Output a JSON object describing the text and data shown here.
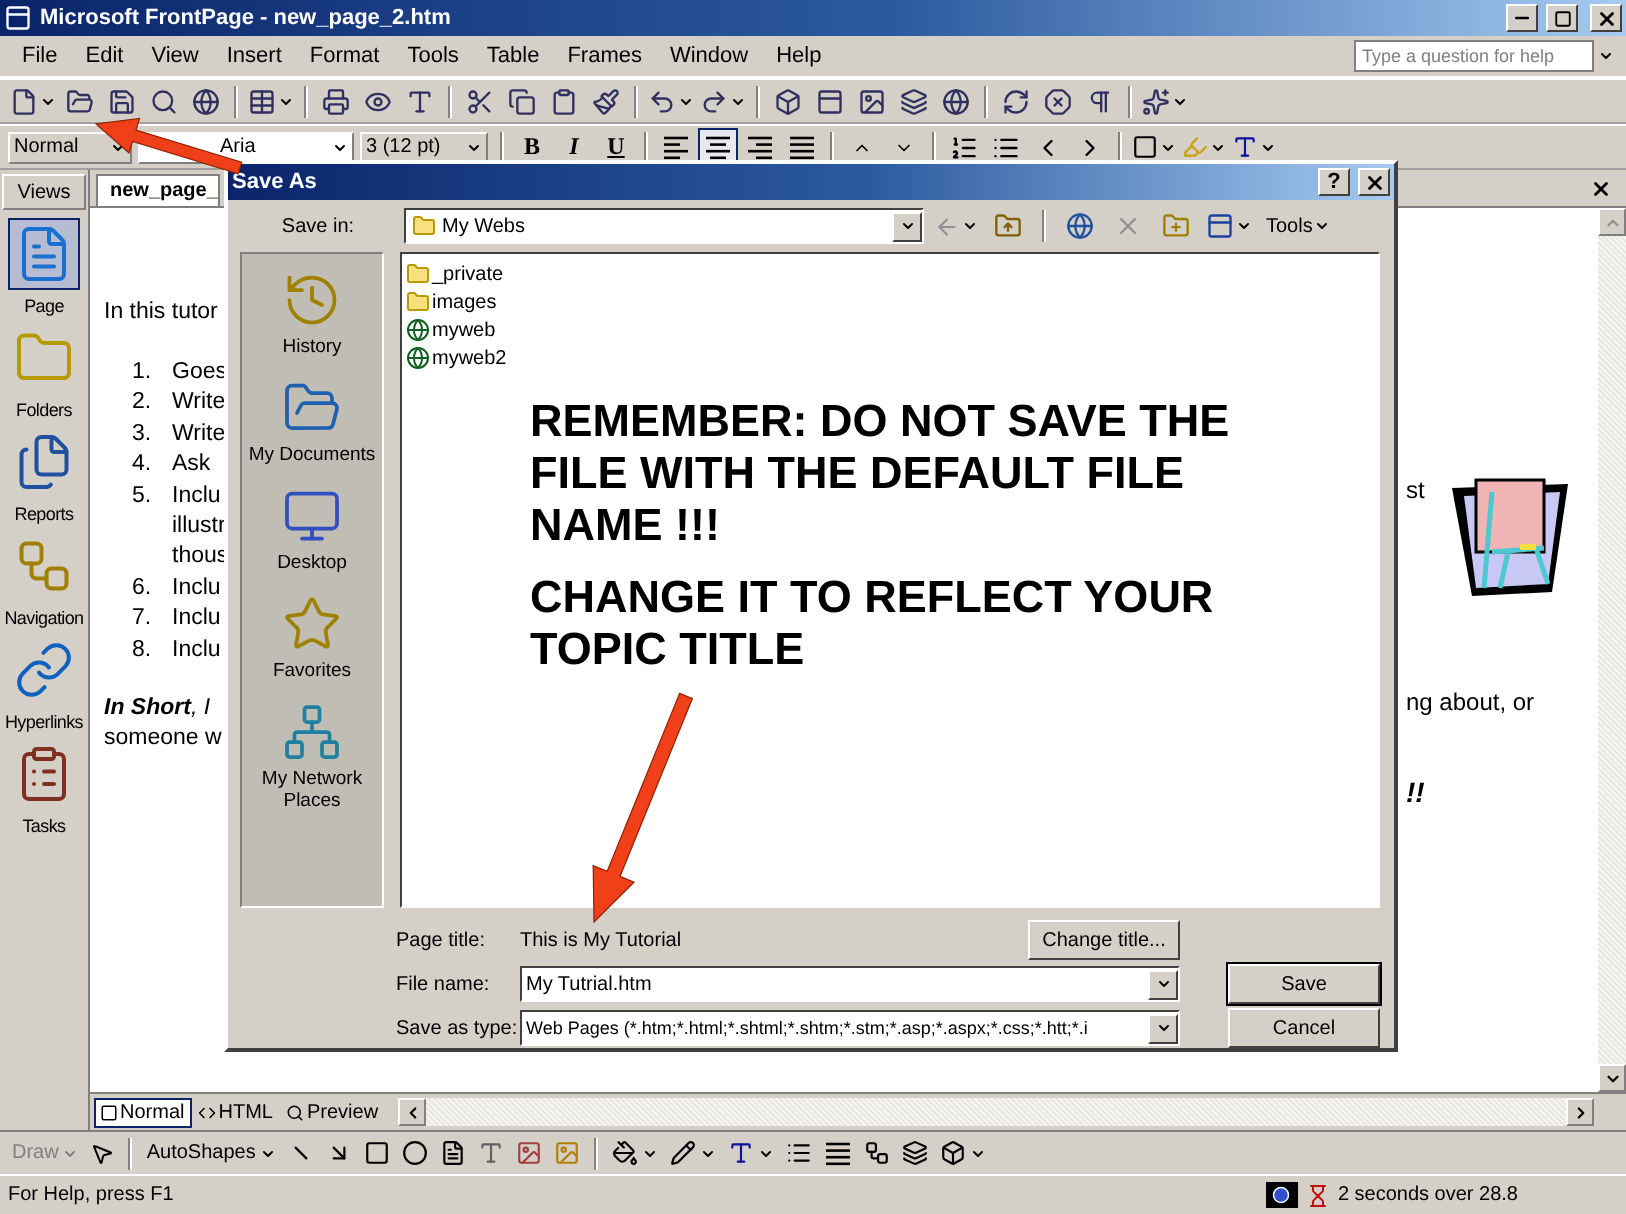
{
  "window": {
    "title": "Microsoft FrontPage - new_page_2.htm"
  },
  "menu": [
    "File",
    "Edit",
    "View",
    "Insert",
    "Format",
    "Tools",
    "Table",
    "Frames",
    "Window",
    "Help"
  ],
  "help_search": {
    "placeholder": "Type a question for help"
  },
  "formatting": {
    "style": "Normal",
    "font": "Aria",
    "size": "3  (12 pt)",
    "buttons": [
      {
        "label": "B",
        "kind": "bold"
      },
      {
        "label": "I",
        "kind": "italic"
      },
      {
        "label": "U",
        "kind": "underline"
      }
    ]
  },
  "views": {
    "title": "Views",
    "items": [
      {
        "label": "Page",
        "selected": true
      },
      {
        "label": "Folders",
        "selected": false
      },
      {
        "label": "Reports",
        "selected": false
      },
      {
        "label": "Navigation",
        "selected": false
      },
      {
        "label": "Hyperlinks",
        "selected": false
      },
      {
        "label": "Tasks",
        "selected": false
      }
    ]
  },
  "document": {
    "tab": "new_page_",
    "intro": "In this tutor",
    "list": [
      {
        "number": "1.",
        "lines": [
          "Goes"
        ]
      },
      {
        "number": "2.",
        "lines": [
          "Write"
        ]
      },
      {
        "number": "3.",
        "lines": [
          "Write"
        ]
      },
      {
        "number": "4.",
        "lines": [
          "Ask"
        ]
      },
      {
        "number": "5.",
        "lines": [
          "Inclu",
          "illustr",
          "thous"
        ]
      },
      {
        "number": "6.",
        "lines": [
          "Inclu"
        ]
      },
      {
        "number": "7.",
        "lines": [
          "Inclu"
        ]
      },
      {
        "number": "8.",
        "lines": [
          "Inclu"
        ]
      }
    ],
    "summary": [
      "**In Short**, I",
      "someone w"
    ],
    "right_fragments": [
      "st",
      "ng about, or",
      "!!"
    ]
  },
  "dialog": {
    "title": "Save As",
    "help_button": "?",
    "save_in_label": "Save in:",
    "save_in": "My Webs",
    "tools": "Tools",
    "places": [
      "History",
      "My Documents",
      "Desktop",
      "Favorites",
      "My Network Places"
    ],
    "files": [
      {
        "name": "_private",
        "kind": "folder"
      },
      {
        "name": "images",
        "kind": "folder"
      },
      {
        "name": "myweb",
        "kind": "web"
      },
      {
        "name": "myweb2",
        "kind": "web"
      }
    ],
    "notice": [
      "REMEMBER: DO NOT SAVE THE FILE WITH THE DEFAULT FILE NAME !!!",
      "CHANGE IT TO REFLECT YOUR TOPIC TITLE"
    ],
    "page_title_label": "Page title:",
    "page_title": "This is My Tutorial",
    "change_title": "Change title...",
    "file_name_label": "File name:",
    "file_name": "My Tutrial.htm",
    "type_label": "Save as type:",
    "type": "Web Pages (*.htm;*.html;*.shtml;*.shtm;*.stm;*.asp;*.aspx;*.css;*.htt;*.i",
    "save": "Save",
    "cancel": "Cancel"
  },
  "view_tabs": [
    {
      "label": "Normal",
      "selected": true
    },
    {
      "label": "HTML",
      "selected": false
    },
    {
      "label": "Preview",
      "selected": false
    }
  ],
  "drawing_toolbar": {
    "draw": "Draw",
    "autoshapes": "AutoShapes"
  },
  "status_bar": {
    "help": "For Help, press F1",
    "timing": "2 seconds over 28.8"
  }
}
